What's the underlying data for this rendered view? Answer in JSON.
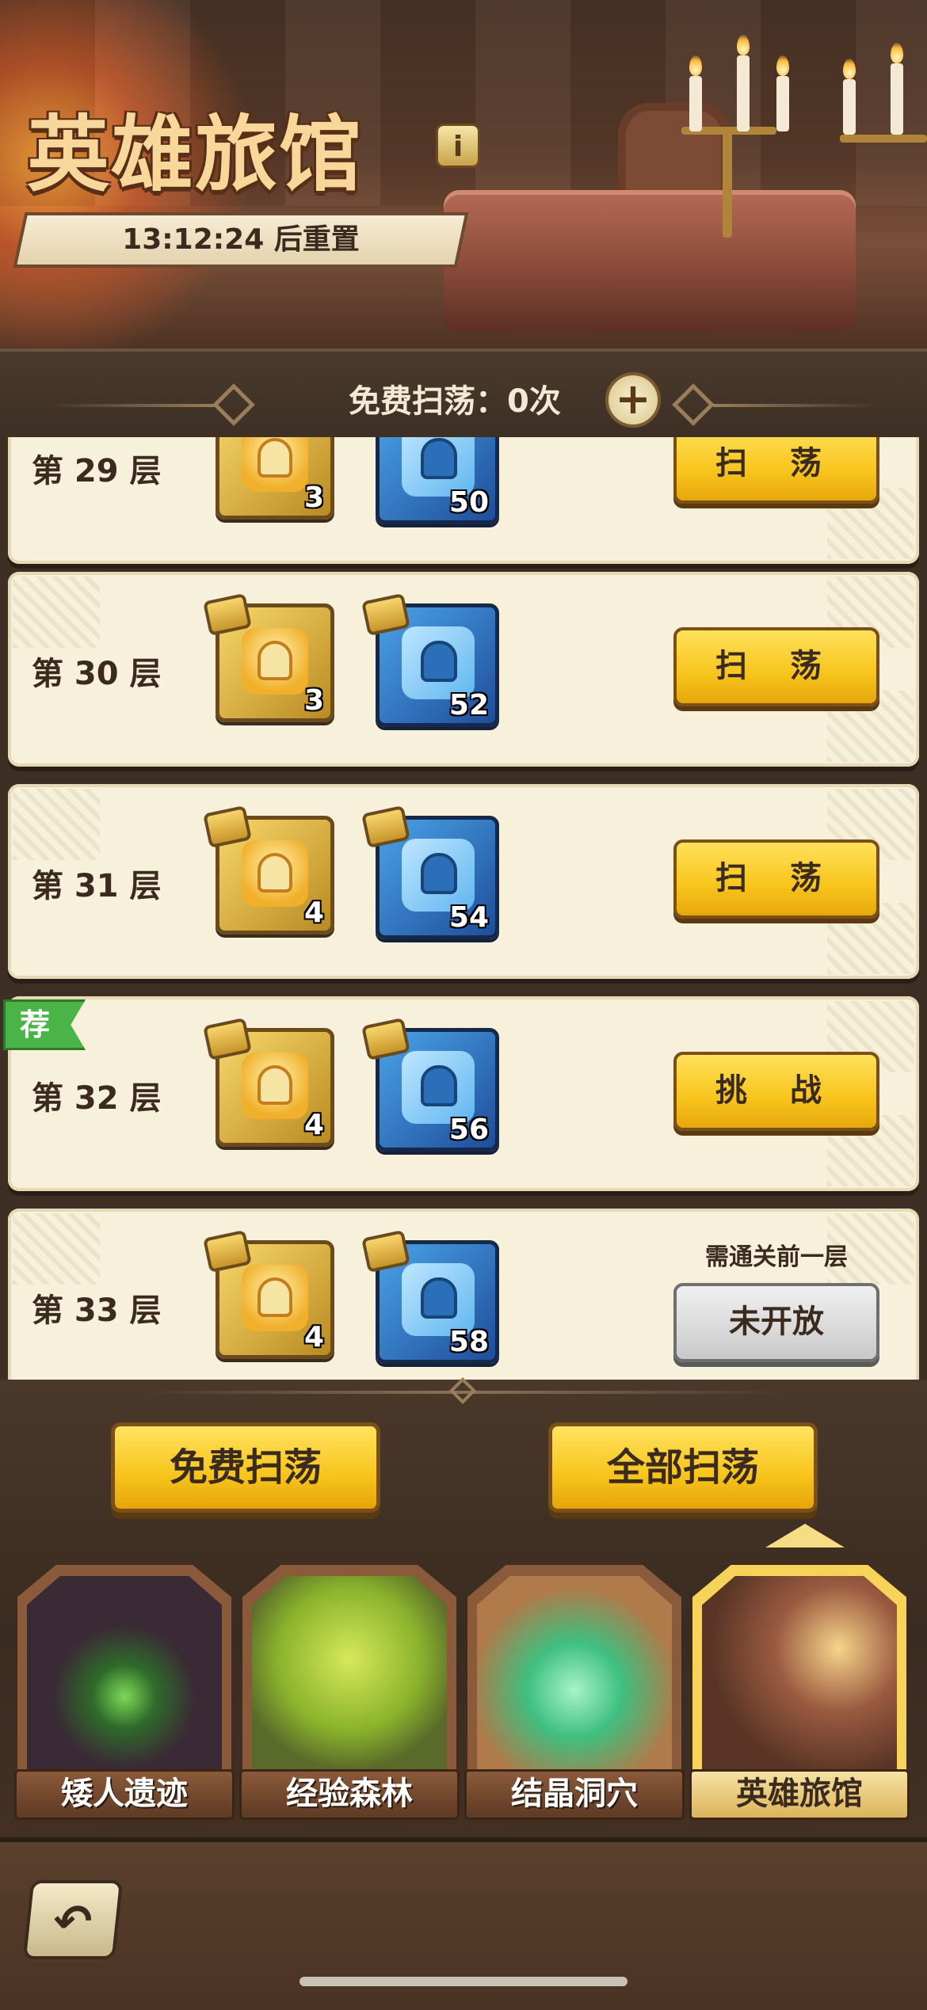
{
  "header": {
    "title": "英雄旅馆",
    "info_icon": "info-icon",
    "reset_timer": "13:12:24 后重置"
  },
  "sweep_bar": {
    "label": "免费扫荡：0次",
    "add_icon": "plus-icon"
  },
  "floors": [
    {
      "name": "第 29 层",
      "gold_count": "3",
      "blue_count": "50",
      "action": "扫 荡",
      "state": "available"
    },
    {
      "name": "第 30 层",
      "gold_count": "3",
      "blue_count": "52",
      "action": "扫 荡",
      "state": "available"
    },
    {
      "name": "第 31 层",
      "gold_count": "4",
      "blue_count": "54",
      "action": "扫 荡",
      "state": "available"
    },
    {
      "name": "第 32 层",
      "gold_count": "4",
      "blue_count": "56",
      "action": "挑 战",
      "state": "challenge",
      "badge": "荐"
    },
    {
      "name": "第 33 层",
      "gold_count": "4",
      "blue_count": "58",
      "action": "未开放",
      "state": "locked",
      "requirement": "需通关前一层"
    }
  ],
  "actions": {
    "free_sweep": "免费扫荡",
    "sweep_all": "全部扫荡"
  },
  "locations": [
    {
      "label": "矮人遗迹",
      "active": false
    },
    {
      "label": "经验森林",
      "active": false
    },
    {
      "label": "结晶洞穴",
      "active": false
    },
    {
      "label": "英雄旅馆",
      "active": true
    }
  ],
  "nav": {
    "back_icon": "back-arrow-icon"
  },
  "colors": {
    "button_yellow": "#f7c41c",
    "panel_cream": "#f7f1dc",
    "frame_brown": "#3d2f24",
    "badge_green": "#4bb449"
  }
}
